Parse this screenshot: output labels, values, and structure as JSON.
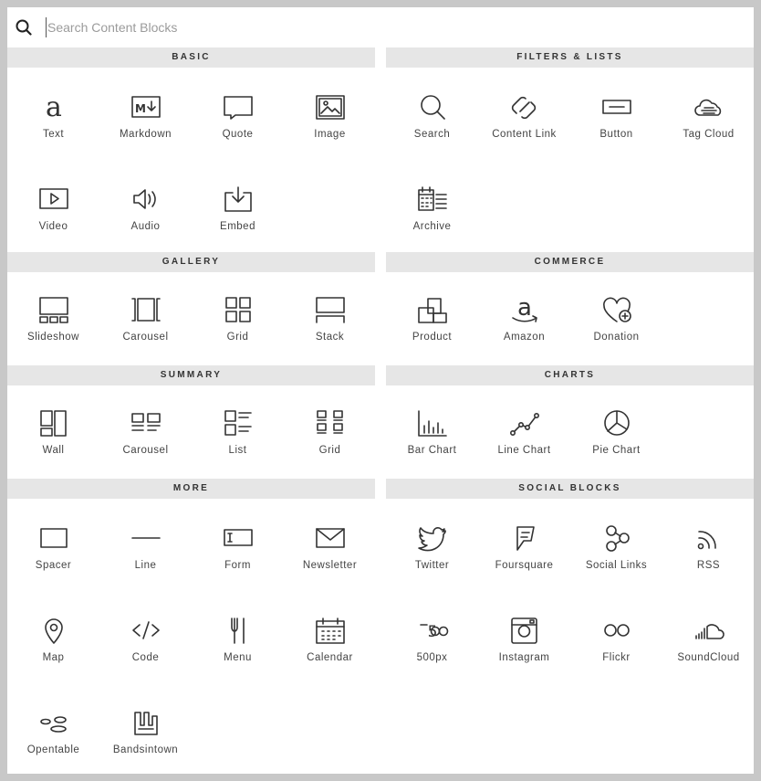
{
  "search": {
    "placeholder": "Search Content Blocks",
    "value": ""
  },
  "left": [
    {
      "header": "BASIC",
      "key": "basic",
      "items": [
        {
          "label": "Text",
          "icon": "text-icon"
        },
        {
          "label": "Markdown",
          "icon": "markdown-icon"
        },
        {
          "label": "Quote",
          "icon": "quote-icon"
        },
        {
          "label": "Image",
          "icon": "image-icon"
        },
        {
          "label": "Video",
          "icon": "video-icon"
        },
        {
          "label": "Audio",
          "icon": "audio-icon"
        },
        {
          "label": "Embed",
          "icon": "embed-icon"
        }
      ]
    },
    {
      "header": "GALLERY",
      "key": "gallery",
      "items": [
        {
          "label": "Slideshow",
          "icon": "slideshow-icon"
        },
        {
          "label": "Carousel",
          "icon": "carousel-icon"
        },
        {
          "label": "Grid",
          "icon": "grid-icon"
        },
        {
          "label": "Stack",
          "icon": "stack-icon"
        }
      ]
    },
    {
      "header": "SUMMARY",
      "key": "summary",
      "items": [
        {
          "label": "Wall",
          "icon": "wall-icon"
        },
        {
          "label": "Carousel",
          "icon": "summary-carousel-icon"
        },
        {
          "label": "List",
          "icon": "list-icon"
        },
        {
          "label": "Grid",
          "icon": "summary-grid-icon"
        }
      ]
    },
    {
      "header": "MORE",
      "key": "more",
      "items": [
        {
          "label": "Spacer",
          "icon": "spacer-icon"
        },
        {
          "label": "Line",
          "icon": "line-icon"
        },
        {
          "label": "Form",
          "icon": "form-icon"
        },
        {
          "label": "Newsletter",
          "icon": "newsletter-icon"
        },
        {
          "label": "Map",
          "icon": "map-pin-icon"
        },
        {
          "label": "Code",
          "icon": "code-icon"
        },
        {
          "label": "Menu",
          "icon": "menu-fork-icon"
        },
        {
          "label": "Calendar",
          "icon": "calendar-icon"
        },
        {
          "label": "Opentable",
          "icon": "opentable-icon"
        },
        {
          "label": "Bandsintown",
          "icon": "bandsintown-icon"
        }
      ]
    }
  ],
  "right": [
    {
      "header": "FILTERS & LISTS",
      "key": "filters",
      "items": [
        {
          "label": "Search",
          "icon": "search-block-icon"
        },
        {
          "label": "Content Link",
          "icon": "content-link-icon"
        },
        {
          "label": "Button",
          "icon": "button-icon"
        },
        {
          "label": "Tag Cloud",
          "icon": "tag-cloud-icon"
        },
        {
          "label": "Archive",
          "icon": "archive-icon"
        }
      ]
    },
    {
      "header": "COMMERCE",
      "key": "commerce",
      "items": [
        {
          "label": "Product",
          "icon": "product-icon"
        },
        {
          "label": "Amazon",
          "icon": "amazon-icon"
        },
        {
          "label": "Donation",
          "icon": "donation-icon"
        }
      ]
    },
    {
      "header": "CHARTS",
      "key": "charts",
      "items": [
        {
          "label": "Bar Chart",
          "icon": "bar-chart-icon"
        },
        {
          "label": "Line Chart",
          "icon": "line-chart-icon"
        },
        {
          "label": "Pie Chart",
          "icon": "pie-chart-icon"
        }
      ]
    },
    {
      "header": "SOCIAL BLOCKS",
      "key": "social",
      "items": [
        {
          "label": "Twitter",
          "icon": "twitter-icon"
        },
        {
          "label": "Foursquare",
          "icon": "foursquare-icon"
        },
        {
          "label": "Social Links",
          "icon": "social-links-icon"
        },
        {
          "label": "RSS",
          "icon": "rss-icon"
        },
        {
          "label": "500px",
          "icon": "500px-icon"
        },
        {
          "label": "Instagram",
          "icon": "instagram-icon"
        },
        {
          "label": "Flickr",
          "icon": "flickr-icon"
        },
        {
          "label": "SoundCloud",
          "icon": "soundcloud-icon"
        }
      ]
    }
  ]
}
